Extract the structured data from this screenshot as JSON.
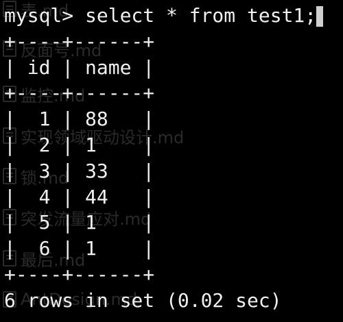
{
  "terminal": {
    "lines": [
      "mysql> select * from test1;",
      "+----+------+",
      "| id | name |",
      "+----+------+",
      "|  1 | 88   |",
      "|  2 | 1    |",
      "|  3 | 33   |",
      "|  4 | 44   |",
      "|  5 | 1    |",
      "|  6 | 1    |",
      "+----+------+",
      "6 rows in set (0.02 sec)"
    ]
  },
  "background_files": [
    "表.md",
    "反面号.md",
    "监控.md",
    "实现领域驱动设计.md",
    "锁.md",
    "突发流量应对.md",
    "最后.md",
    "AntDesign.md"
  ],
  "colors": {
    "background": "#000000",
    "text": "#f0f0f0",
    "ghost_text": "#2a2a2a"
  }
}
